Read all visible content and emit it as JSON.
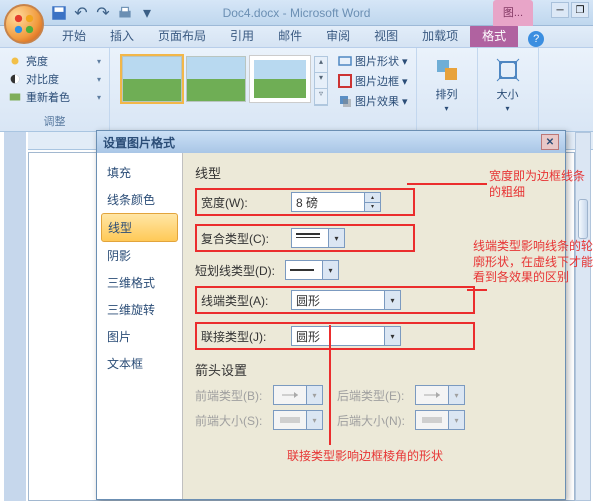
{
  "titlebar": {
    "doc_title": "Doc4.docx - Microsoft Word",
    "context_tab": "图..."
  },
  "ribbon": {
    "tabs": [
      "开始",
      "插入",
      "页面布局",
      "引用",
      "邮件",
      "审阅",
      "视图",
      "加载项",
      "格式"
    ],
    "active_tab": "格式",
    "adjust": {
      "brightness": "亮度",
      "contrast": "对比度",
      "recolor": "重新着色",
      "group": "调整"
    },
    "pic_fmt": {
      "shape": "图片形状",
      "border": "图片边框",
      "effects": "图片效果"
    },
    "arrange": "排列",
    "size": "大小"
  },
  "dialog": {
    "title": "设置图片格式",
    "nav": [
      "填充",
      "线条颜色",
      "线型",
      "阴影",
      "三维格式",
      "三维旋转",
      "图片",
      "文本框"
    ],
    "active_nav": "线型",
    "section": "线型",
    "width_label": "宽度(W):",
    "width_value": "8 磅",
    "compound_label": "复合类型(C):",
    "dash_label": "短划线类型(D):",
    "cap_label": "线端类型(A):",
    "cap_value": "圆形",
    "join_label": "联接类型(J):",
    "join_value": "圆形",
    "arrow_section": "箭头设置",
    "begin_type": "前端类型(B):",
    "end_type": "后端类型(E):",
    "begin_size": "前端大小(S):",
    "end_size": "后端大小(N):"
  },
  "annotations": {
    "a1": "宽度即为边框线条的粗细",
    "a2": "线端类型影响线条的轮廓形状，在虚线下才能看到各效果的区别",
    "a3": "联接类型影响边框棱角的形状"
  }
}
